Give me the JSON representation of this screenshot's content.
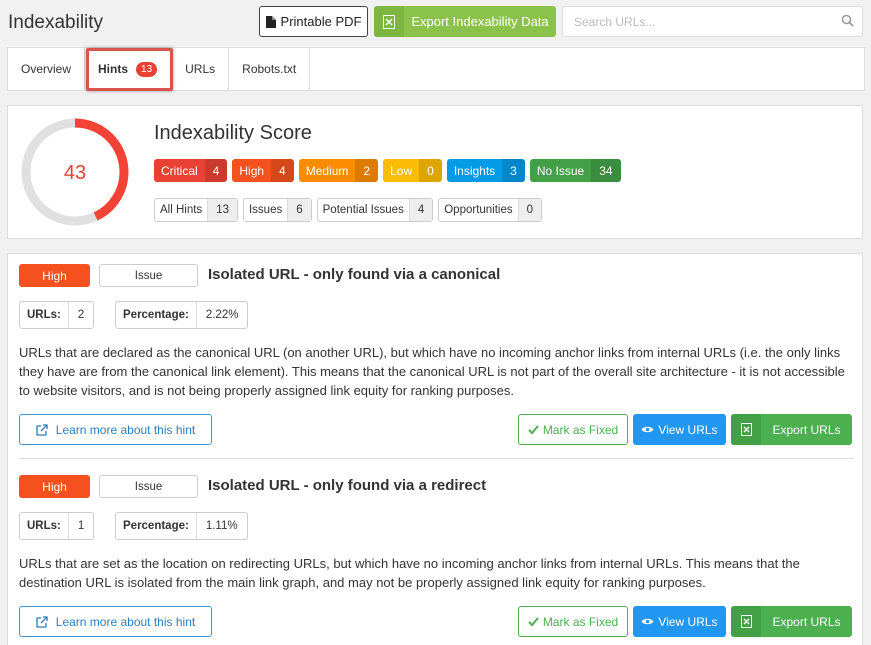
{
  "header": {
    "title": "Indexability",
    "pdf_label": "Printable PDF",
    "export_label": "Export Indexability Data",
    "search_placeholder": "Search URLs..."
  },
  "tabs": [
    {
      "label": "Overview"
    },
    {
      "label": "Hints",
      "count": "13"
    },
    {
      "label": "URLs"
    },
    {
      "label": "Robots.txt"
    }
  ],
  "score": {
    "value": 43,
    "title": "Indexability Score",
    "severities": [
      {
        "name": "Critical",
        "count": "4",
        "color": "#e94235"
      },
      {
        "name": "High",
        "count": "4",
        "color": "#f4511e"
      },
      {
        "name": "Medium",
        "count": "2",
        "color": "#fb8c00"
      },
      {
        "name": "Low",
        "count": "0",
        "color": "#fbbc05"
      },
      {
        "name": "Insights",
        "count": "3",
        "color": "#039be5"
      },
      {
        "name": "No Issue",
        "count": "34",
        "color": "#43a047"
      }
    ],
    "hint_types": [
      {
        "name": "All Hints",
        "count": "13"
      },
      {
        "name": "Issues",
        "count": "6"
      },
      {
        "name": "Potential Issues",
        "count": "4"
      },
      {
        "name": "Opportunities",
        "count": "0"
      }
    ],
    "colors": {
      "ring": "#f44336",
      "track": "#e0e0e0"
    }
  },
  "hints": [
    {
      "level": "High",
      "type": "Issue",
      "title": "Isolated URL - only found via a canonical",
      "urls_label": "URLs:",
      "urls_value": "2",
      "pct_label": "Percentage:",
      "pct_value": "2.22%",
      "description": "URLs that are declared as the canonical URL (on another URL), but which have no incoming anchor links from internal URLs (i.e. the only links they have are from the canonical link element). This means that the canonical URL is not part of the overall site architecture - it is not accessible to website visitors, and is not being properly assigned link equity for ranking purposes.",
      "learn_label": "Learn more about this hint",
      "mark_label": "Mark as Fixed",
      "view_label": "View URLs",
      "export_label": "Export URLs"
    },
    {
      "level": "High",
      "type": "Issue",
      "title": "Isolated URL - only found via a redirect",
      "urls_label": "URLs:",
      "urls_value": "1",
      "pct_label": "Percentage:",
      "pct_value": "1.11%",
      "description": "URLs that are set as the location on redirecting URLs, but which have no incoming anchor links from internal URLs. This means that the destination URL is isolated from the main link graph, and may not be properly assigned link equity for ranking purposes.",
      "learn_label": "Learn more about this hint",
      "mark_label": "Mark as Fixed",
      "view_label": "View URLs",
      "export_label": "Export URLs"
    }
  ]
}
